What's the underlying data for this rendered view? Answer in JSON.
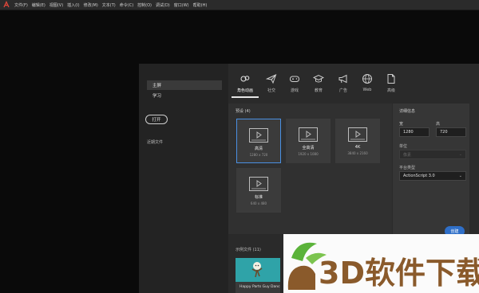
{
  "menubar": {
    "logo_icon": "animate-logo-icon",
    "items": [
      "文件(F)",
      "编辑(E)",
      "视图(V)",
      "插入(I)",
      "修改(M)",
      "文本(T)",
      "命令(C)",
      "控制(O)",
      "调试(D)",
      "窗口(W)",
      "帮助(H)"
    ]
  },
  "leftnav": {
    "home": "主屏",
    "learn": "学习",
    "open_button": "打开",
    "recent_files": "近期文件"
  },
  "categories": [
    {
      "label": "角色动画",
      "icon": "character-animation-icon"
    },
    {
      "label": "社交",
      "icon": "social-paper-plane-icon"
    },
    {
      "label": "游戏",
      "icon": "gamepad-icon"
    },
    {
      "label": "教育",
      "icon": "graduation-cap-icon"
    },
    {
      "label": "广告",
      "icon": "megaphone-icon"
    },
    {
      "label": "Web",
      "icon": "globe-icon"
    },
    {
      "label": "高级",
      "icon": "document-icon"
    }
  ],
  "presets": {
    "title": "预设 (4)",
    "items": [
      {
        "name": "高清",
        "resolution": "1280 x 720"
      },
      {
        "name": "全高清",
        "resolution": "1920 x 1080"
      },
      {
        "name": "4K",
        "resolution": "3840 x 2160"
      },
      {
        "name": "标准",
        "resolution": "640 x 480"
      }
    ]
  },
  "details": {
    "title": "详细信息",
    "width_label": "宽",
    "height_label": "高",
    "width_value": "1280",
    "height_value": "720",
    "units_label": "单位",
    "units_value": "像素",
    "platform_label": "平台类型",
    "platform_value": "ActionScript 3.0"
  },
  "create_button": "创建",
  "samples": {
    "title": "示例文件 (11)",
    "items": [
      {
        "name": "Happy Parts Guy Dance"
      }
    ]
  },
  "watermark": {
    "text": "3D软件下载",
    "colors": {
      "green": "#5bb33a",
      "brown": "#8a5a2b"
    }
  },
  "colors": {
    "accent": "#2f6fc8",
    "selected_border": "#4a90e2"
  }
}
